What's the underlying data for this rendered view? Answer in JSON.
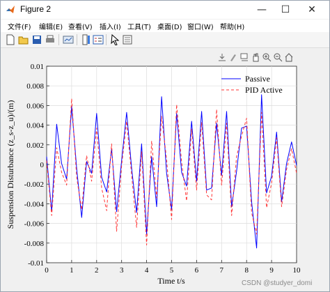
{
  "window": {
    "title": "Figure 2",
    "minimize_glyph": "—",
    "maximize_glyph": "☐",
    "close_glyph": "✕"
  },
  "menu": [
    {
      "label": "文件(F)"
    },
    {
      "label": "编辑(E)"
    },
    {
      "label": "查看(V)"
    },
    {
      "label": "插入(I)"
    },
    {
      "label": "工具(T)"
    },
    {
      "label": "桌面(D)"
    },
    {
      "label": "窗口(W)"
    },
    {
      "label": "帮助(H)"
    }
  ],
  "toolbar_icons": [
    "new-figure-icon",
    "open-file-icon",
    "save-icon",
    "print-icon",
    "link-plot-icon",
    "colorbar-icon",
    "legend-icon",
    "pointer-icon",
    "property-inspector-icon"
  ],
  "axes_toolbar_icons": [
    "export-icon",
    "brush-icon",
    "datatip-icon",
    "pan-icon",
    "zoom-in-icon",
    "zoom-out-icon",
    "home-icon"
  ],
  "watermark": "CSDN @studyer_domi",
  "chart_data": {
    "type": "line",
    "title": "",
    "xlabel": "Time t/s",
    "ylabel": "Suspension Disturbance (z_s-z_u)/(m)",
    "xlim": [
      0,
      10
    ],
    "ylim": [
      -0.01,
      0.01
    ],
    "xticks": [
      "0",
      "1",
      "2",
      "3",
      "4",
      "5",
      "6",
      "7",
      "8",
      "9",
      "10"
    ],
    "yticks": [
      "-0.01",
      "-0.008",
      "-0.006",
      "-0.004",
      "-0.002",
      "0",
      "0.002",
      "0.004",
      "0.006",
      "0.008",
      "0.01"
    ],
    "grid": true,
    "legend_position": "top-right",
    "x": [
      0.0,
      0.2,
      0.4,
      0.6,
      0.8,
      1.0,
      1.2,
      1.4,
      1.6,
      1.8,
      2.0,
      2.2,
      2.4,
      2.6,
      2.8,
      3.0,
      3.2,
      3.4,
      3.6,
      3.8,
      4.0,
      4.2,
      4.4,
      4.6,
      4.8,
      5.0,
      5.2,
      5.4,
      5.6,
      5.8,
      6.0,
      6.2,
      6.4,
      6.6,
      6.8,
      7.0,
      7.2,
      7.4,
      7.6,
      7.8,
      8.0,
      8.2,
      8.4,
      8.6,
      8.8,
      9.0,
      9.2,
      9.4,
      9.6,
      9.8,
      10.0
    ],
    "series": [
      {
        "name": "Passive",
        "color": "#0000ff",
        "style": "solid",
        "values": [
          0.0008,
          -0.0048,
          0.0041,
          0.0001,
          -0.0015,
          0.0059,
          -0.0004,
          -0.0054,
          0.0003,
          -0.0009,
          0.0052,
          -0.0013,
          -0.0028,
          0.0016,
          -0.0048,
          0.0004,
          0.0053,
          -0.0004,
          -0.0049,
          0.0021,
          -0.0071,
          0.0008,
          -0.0043,
          0.0069,
          -0.0009,
          -0.0046,
          0.0052,
          -0.0008,
          -0.0022,
          0.0044,
          -0.0017,
          0.0054,
          -0.0026,
          -0.0024,
          0.0042,
          -0.0011,
          0.0054,
          -0.0043,
          -0.0007,
          0.0037,
          0.0039,
          -0.0038,
          -0.0085,
          0.0071,
          -0.0029,
          -0.0012,
          0.0033,
          -0.0038,
          0.0001,
          0.0023,
          -0.0001
        ]
      },
      {
        "name": "PID Active",
        "color": "#ff3333",
        "style": "dashed",
        "values": [
          0.0004,
          -0.0052,
          0.0017,
          -0.0008,
          -0.0021,
          0.0067,
          -0.0013,
          -0.0046,
          0.0009,
          -0.0017,
          0.0037,
          -0.0024,
          -0.0047,
          0.0021,
          -0.0068,
          -0.0001,
          0.0044,
          -0.0011,
          -0.0064,
          0.0013,
          -0.0082,
          0.0024,
          -0.0034,
          0.0049,
          0.0005,
          -0.0056,
          0.0061,
          0.0002,
          -0.0037,
          0.0036,
          -0.0026,
          0.0043,
          -0.0031,
          -0.0036,
          0.0056,
          -0.0021,
          0.0042,
          -0.0052,
          0.0008,
          0.0029,
          0.0047,
          -0.0049,
          -0.0071,
          0.0053,
          -0.0044,
          -0.0019,
          0.0027,
          -0.0043,
          -0.0005,
          0.0016,
          -0.0009
        ]
      }
    ]
  }
}
